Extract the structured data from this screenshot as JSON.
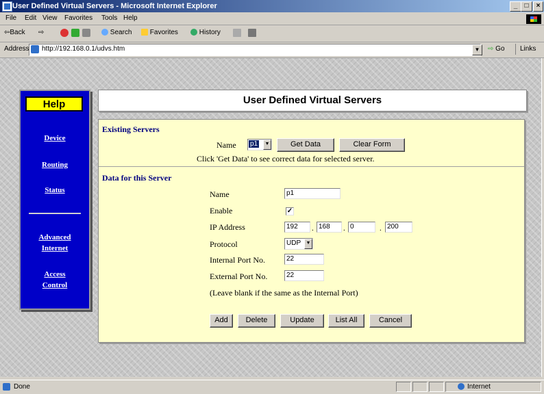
{
  "window": {
    "title": "User Defined Virtual Servers - Microsoft Internet Explorer",
    "controls": [
      "_",
      "□",
      "×"
    ]
  },
  "menu": [
    "File",
    "Edit",
    "View",
    "Favorites",
    "Tools",
    "Help"
  ],
  "toolbar": {
    "back": "⇦Back",
    "forward": "⇨",
    "search": "Search",
    "favorites": "Favorites",
    "history": "History"
  },
  "address": {
    "label": "Address",
    "url": "http://192.168.0.1/udvs.htm",
    "go": "Go",
    "links": "Links"
  },
  "sidebar": {
    "help": "Help",
    "items": [
      "Device",
      "Routing",
      "Status",
      "Advanced",
      "Internet",
      "Access",
      "Control"
    ]
  },
  "header": {
    "title": "User Defined Virtual Servers"
  },
  "existing": {
    "title": "Existing Servers",
    "name_label": "Name",
    "selected": "p1",
    "get_data": "Get Data",
    "clear_form": "Clear Form",
    "hint": "Click 'Get Data' to see correct data for selected server."
  },
  "form": {
    "title": "Data for this Server",
    "name_label": "Name",
    "name_value": "p1",
    "enable_label": "Enable",
    "enable_checked": "✓",
    "ip_label": "IP Address",
    "ip": [
      "192",
      "168",
      "0",
      "200"
    ],
    "ip_sep": ".",
    "protocol_label": "Protocol",
    "protocol_value": "UDP",
    "internal_label": "Internal Port No.",
    "internal_value": "22",
    "external_label": "External Port No.",
    "external_value": "22",
    "note": "(Leave blank if the same as the Internal Port)"
  },
  "actions": [
    "Add",
    "Delete",
    "Update",
    "List All",
    "Cancel"
  ],
  "status": {
    "text": "Done",
    "zone": "Internet"
  }
}
